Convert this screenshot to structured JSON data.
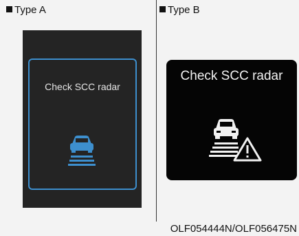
{
  "type_a": {
    "label": "Type A",
    "message": "Check SCC radar",
    "accent": "#3d8fce"
  },
  "type_b": {
    "label": "Type B",
    "message": "Check SCC radar"
  },
  "footer": {
    "code": "OLF054444N/OLF056475N"
  },
  "icons": {
    "a": "car-radar-icon",
    "b": "car-radar-warning-icon"
  }
}
